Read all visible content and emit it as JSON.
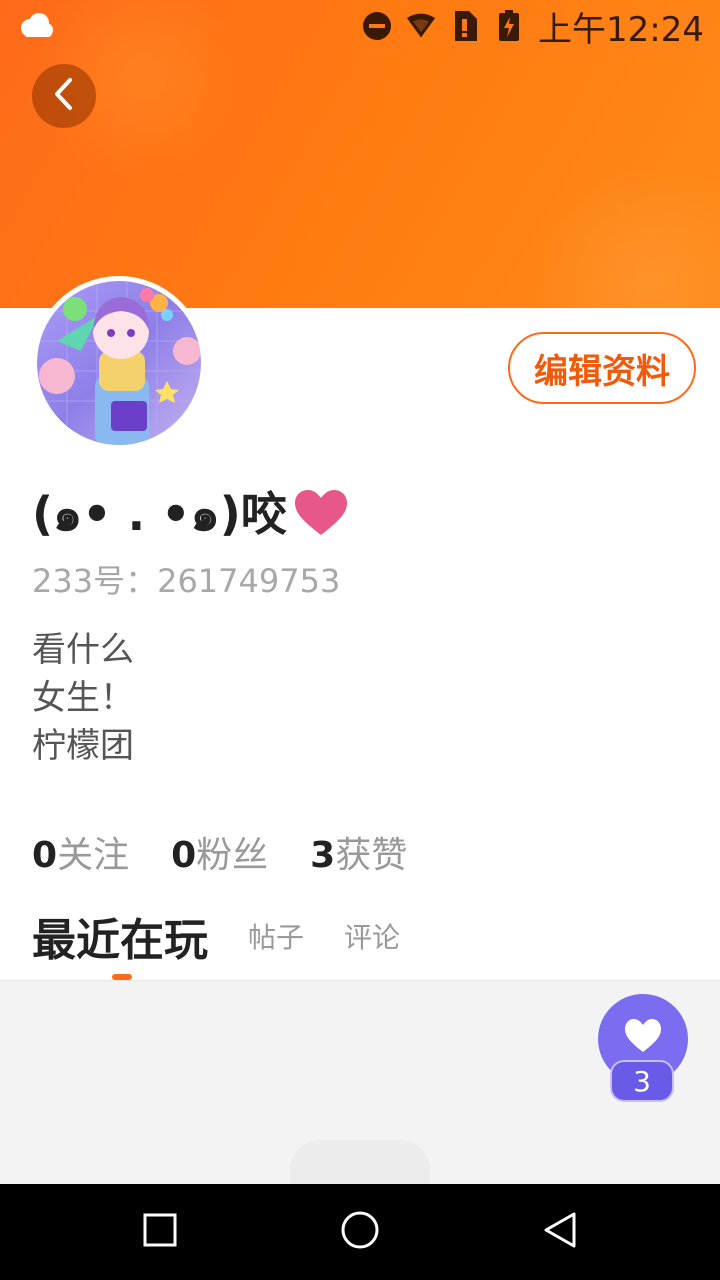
{
  "status_bar": {
    "time": "上午12:24",
    "icons": [
      "weather-cloud-icon",
      "do-not-disturb-icon",
      "wifi-icon",
      "sim-alert-icon",
      "battery-charging-icon"
    ]
  },
  "header": {
    "back_icon": "chevron-left-icon",
    "banner_color": "#ff7312"
  },
  "profile": {
    "username": "(๑• . •๑)咬",
    "uid_label": "233号：261749753",
    "bio_lines": [
      "看什么",
      "女生！",
      "柠檬团"
    ],
    "edit_button": "编辑资料"
  },
  "stats": [
    {
      "num": "0",
      "label": "关注"
    },
    {
      "num": "0",
      "label": "粉丝"
    },
    {
      "num": "3",
      "label": "获赞"
    }
  ],
  "tabs": [
    {
      "label": "最近在玩",
      "active": true
    },
    {
      "label": "帖子",
      "active": false
    },
    {
      "label": "评论",
      "active": false
    }
  ],
  "like_fab": {
    "count": "3",
    "icon": "heart-icon",
    "color": "#7b6cf0"
  },
  "accent_color": "#ff6a1a"
}
